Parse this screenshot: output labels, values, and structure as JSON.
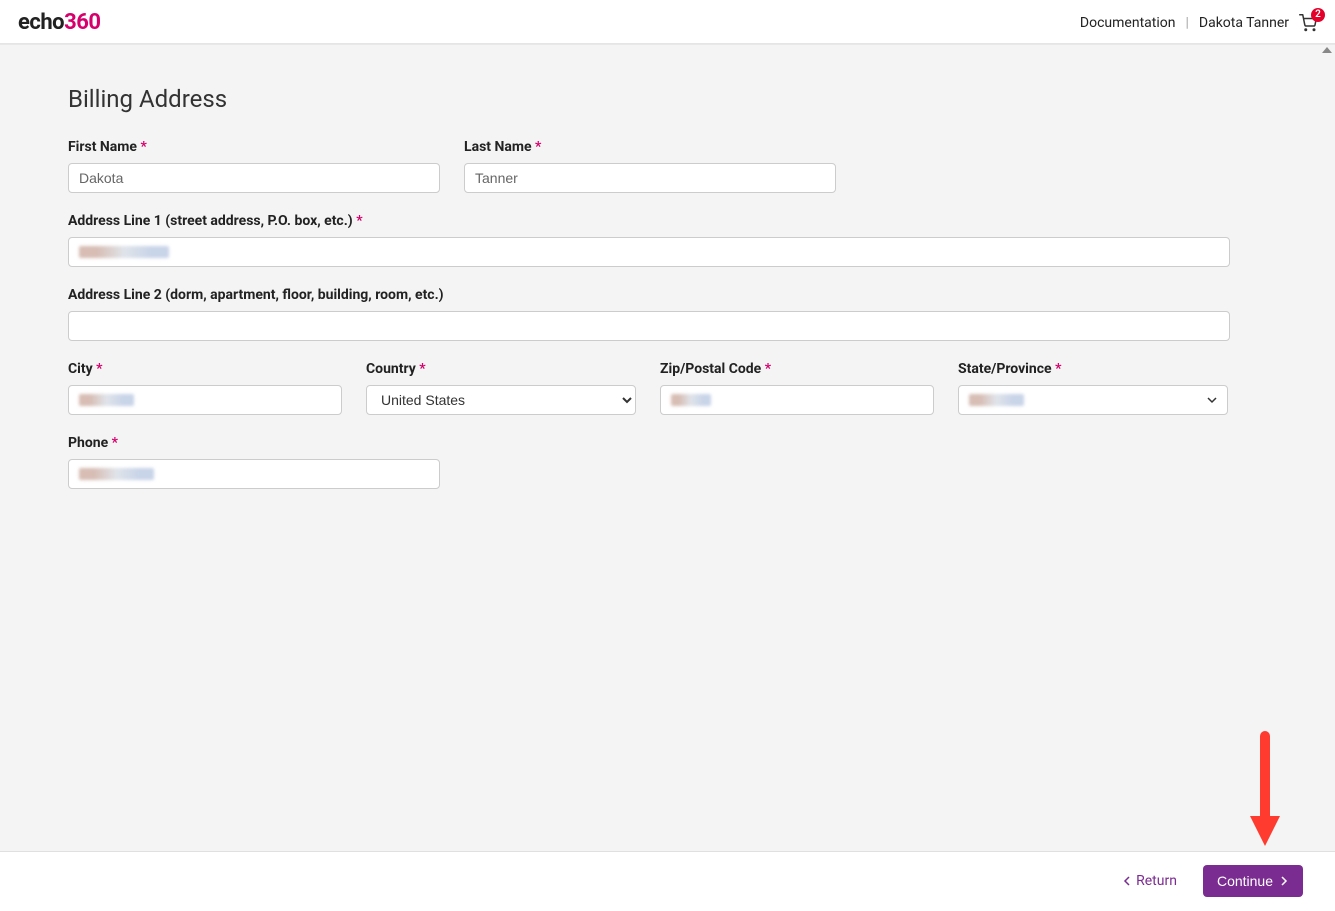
{
  "header": {
    "logo_part1": "echo",
    "logo_part2": "360",
    "documentation_link": "Documentation",
    "user_name": "Dakota Tanner",
    "cart_count": "2"
  },
  "page": {
    "title": "Billing Address"
  },
  "form": {
    "first_name": {
      "label": "First Name",
      "value": "Dakota",
      "required": true
    },
    "last_name": {
      "label": "Last Name",
      "value": "Tanner",
      "required": true
    },
    "address1": {
      "label": "Address Line 1 (street address, P.O. box, etc.)",
      "value": "",
      "required": true
    },
    "address2": {
      "label": "Address Line 2 (dorm, apartment, floor, building, room, etc.)",
      "value": "",
      "required": false
    },
    "city": {
      "label": "City",
      "value": "",
      "required": true
    },
    "country": {
      "label": "Country",
      "value": "United States",
      "required": true
    },
    "zip": {
      "label": "Zip/Postal Code",
      "value": "",
      "required": true
    },
    "state": {
      "label": "State/Province",
      "value": "",
      "required": true
    },
    "phone": {
      "label": "Phone",
      "value": "",
      "required": true
    }
  },
  "required_mark": "*",
  "footer": {
    "return_label": "Return",
    "continue_label": "Continue"
  }
}
